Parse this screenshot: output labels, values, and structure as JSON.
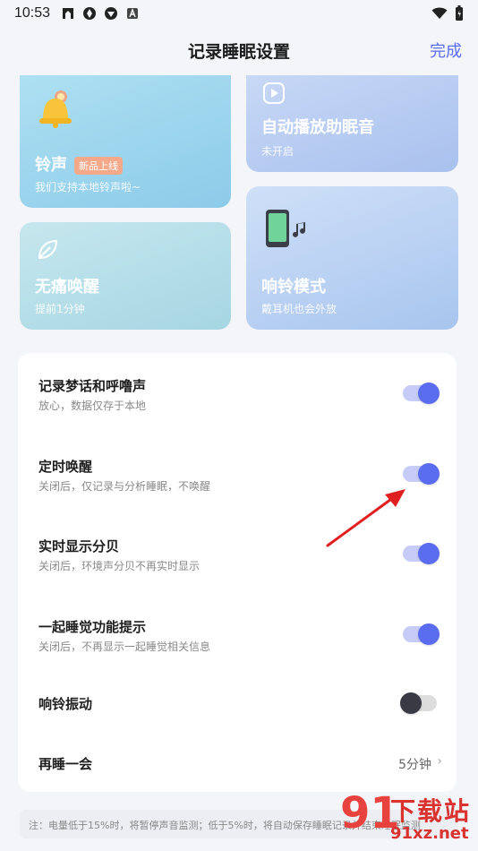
{
  "status_bar": {
    "time": "10:53"
  },
  "header": {
    "title": "记录睡眠设置",
    "done_label": "完成"
  },
  "cards": {
    "ringtone": {
      "title": "铃声",
      "badge": "新品上线",
      "subtitle": "我们支持本地铃声啦~"
    },
    "autoplay": {
      "title": "自动播放助眠音",
      "subtitle": "未开启"
    },
    "painless": {
      "title": "无痛唤醒",
      "subtitle": "提前1分钟"
    },
    "ringmode": {
      "title": "响铃模式",
      "subtitle": "戴耳机也会外放"
    }
  },
  "settings": [
    {
      "label": "记录梦话和呼噜声",
      "desc": "放心，数据仅存于本地",
      "state": "on"
    },
    {
      "label": "定时唤醒",
      "desc": "关闭后，仅记录与分析睡眠，不唤醒",
      "state": "on"
    },
    {
      "label": "实时显示分贝",
      "desc": "关闭后，环境声分贝不再实时显示",
      "state": "on"
    },
    {
      "label": "一起睡觉功能提示",
      "desc": "关闭后，不再显示一起睡觉相关信息",
      "state": "on"
    },
    {
      "label": "响铃振动",
      "desc": "",
      "state": "off"
    },
    {
      "label": "再睡一会",
      "value": "5分钟"
    }
  ],
  "footer_note": "注：电量低于15%时，将暂停声音监测；低于5%时，将自动保存睡眠记录并结束睡眠监测",
  "watermark": {
    "brand": "下载站",
    "url": "91xz.net",
    "logo": "91"
  },
  "colors": {
    "accent": "#5a6cf0",
    "toggle_track_on": "#c6ccf6",
    "toggle_off_knob": "#3a3a44",
    "annotation_arrow": "#e02020"
  }
}
